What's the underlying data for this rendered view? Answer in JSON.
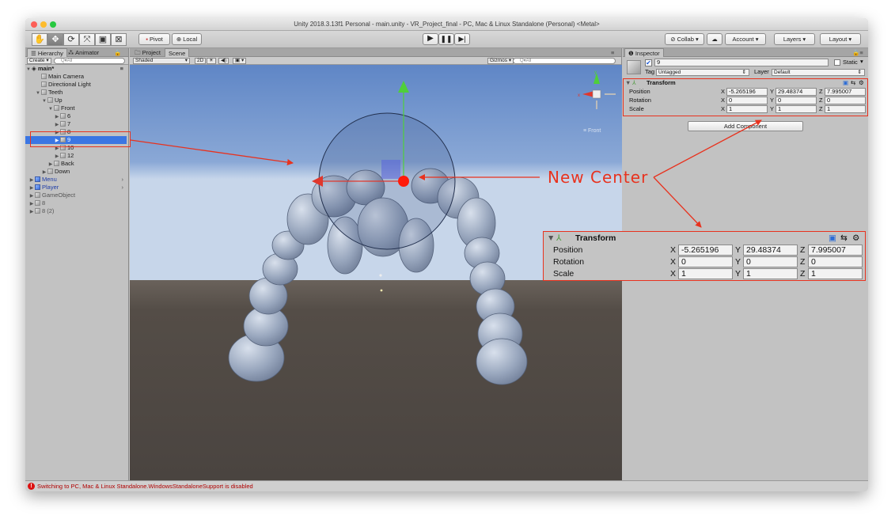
{
  "window": {
    "title": "Unity 2018.3.13f1 Personal - main.unity - VR_Project_final - PC, Mac & Linux Standalone (Personal) <Metal>"
  },
  "toolbar": {
    "pivot_label": "Pivot",
    "local_label": "Local",
    "collab_label": "Collab ▾",
    "account_label": "Account",
    "layers_label": "Layers",
    "layout_label": "Layout"
  },
  "hierarchy": {
    "tab_label": "Hierarchy",
    "animator_tab_label": "Animator",
    "create_label": "Create ▾",
    "search_placeholder": "Q▾All",
    "scene_name": "main*",
    "rows": [
      "Main Camera",
      "Directional Light",
      "Teeth",
      "Up",
      "Front",
      "6",
      "7",
      "8",
      "9",
      "10",
      "12",
      "Back",
      "Down",
      "Menu",
      "Player",
      "GameObject",
      "8",
      "8 (2)"
    ]
  },
  "scene": {
    "project_tab_label": "Project",
    "scene_tab_label": "Scene",
    "shaded_label": "Shaded",
    "mode_2d_label": "2D",
    "gizmos_label": "Gizmos ▾",
    "search_placeholder": "Q▾All",
    "view_label": "≡ Front"
  },
  "annotation": {
    "label": "New Center"
  },
  "inspector": {
    "tab_label": "Inspector",
    "object_name": "9",
    "static_label": "Static",
    "tag_label": "Tag",
    "tag_value": "Untagged",
    "layer_label": "Layer",
    "layer_value": "Default",
    "component_title": "Transform",
    "position_label": "Position",
    "rotation_label": "Rotation",
    "scale_label": "Scale",
    "axis_x": "X",
    "axis_y": "Y",
    "axis_z": "Z",
    "position": {
      "x": "-5.265196",
      "y": "29.48374",
      "z": "7.995007"
    },
    "rotation": {
      "x": "0",
      "y": "0",
      "z": "0"
    },
    "scale": {
      "x": "1",
      "y": "1",
      "z": "1"
    },
    "add_component_label": "Add Component"
  },
  "status": {
    "message": "Switching to PC, Mac & Linux Standalone.WindowsStandaloneSupport is disabled"
  },
  "colors": {
    "selection": "#3b76e3",
    "annotation": "#e8321e",
    "sky_top": "#5f86c6",
    "ground": "#4d4742"
  }
}
